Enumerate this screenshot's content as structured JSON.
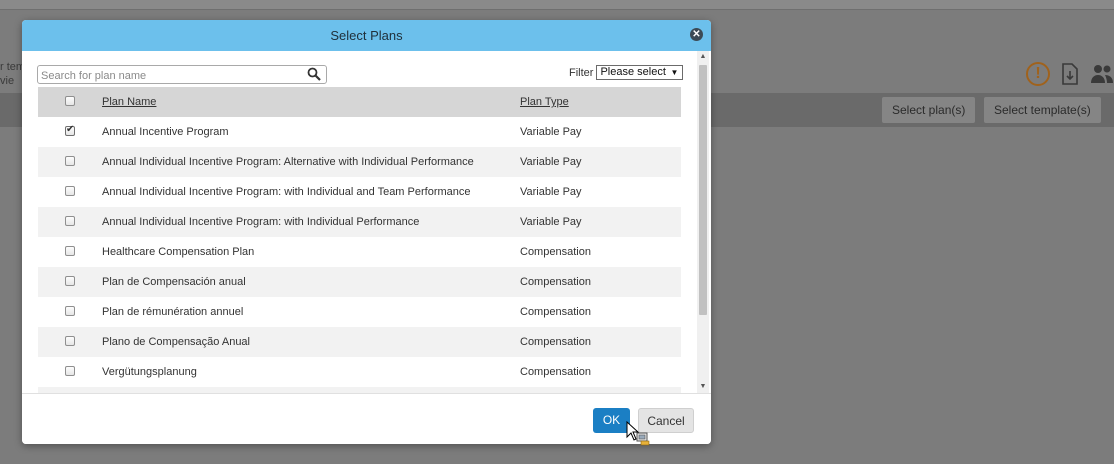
{
  "background": {
    "side_text_1": "r tem",
    "side_text_2": "vie",
    "buttons": {
      "select_plans": "Select plan(s)",
      "select_templates": "Select template(s)"
    }
  },
  "modal": {
    "title": "Select Plans",
    "search": {
      "placeholder": "Search for plan name",
      "value": ""
    },
    "filter": {
      "label": "Filter",
      "selected": "Please select"
    },
    "table": {
      "headers": {
        "name": "Plan Name",
        "type": "Plan Type"
      },
      "rows": [
        {
          "name": "Annual Incentive Program",
          "type": "Variable Pay",
          "checked": true
        },
        {
          "name": "Annual Individual Incentive Program: Alternative with Individual Performance",
          "type": "Variable Pay",
          "checked": false
        },
        {
          "name": "Annual Individual Incentive Program: with Individual and Team Performance",
          "type": "Variable Pay",
          "checked": false
        },
        {
          "name": "Annual Individual Incentive Program: with Individual Performance",
          "type": "Variable Pay",
          "checked": false
        },
        {
          "name": "Healthcare Compensation Plan",
          "type": "Compensation",
          "checked": false
        },
        {
          "name": "Plan de Compensación anual",
          "type": "Compensation",
          "checked": false
        },
        {
          "name": "Plan de rémunération annuel",
          "type": "Compensation",
          "checked": false
        },
        {
          "name": "Plano de Compensação Anual",
          "type": "Compensation",
          "checked": false
        },
        {
          "name": "Vergütungsplanung",
          "type": "Compensation",
          "checked": false
        }
      ]
    },
    "footer": {
      "ok": "OK",
      "cancel": "Cancel"
    }
  },
  "colors": {
    "header": "#6cc0ec",
    "ok_button": "#1b7fc4",
    "table_header": "#d6d6d6"
  }
}
